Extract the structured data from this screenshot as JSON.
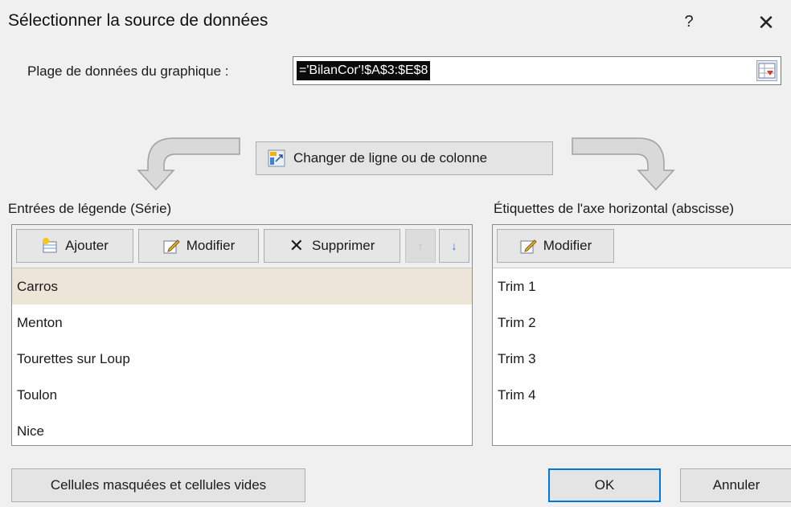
{
  "dialog": {
    "title": "Sélectionner la source de données",
    "help_label": "?",
    "close_label": "✕"
  },
  "range": {
    "label": "Plage de données du graphique :",
    "value": "='BilanCor'!$A$3:$E$8"
  },
  "switch_button": {
    "label": "Changer de ligne ou de colonne"
  },
  "legend": {
    "header": "Entrées de légende (Série)",
    "add_label": "Ajouter",
    "edit_label": "Modifier",
    "delete_label": "Supprimer",
    "up_label": "↑",
    "down_label": "↓",
    "items": [
      "Carros",
      "Menton",
      "Tourettes sur Loup",
      "Toulon",
      "Nice"
    ],
    "selected_index": 0
  },
  "axis": {
    "header": "Étiquettes de l'axe horizontal (abscisse)",
    "edit_label": "Modifier",
    "items": [
      "Trim 1",
      "Trim 2",
      "Trim 3",
      "Trim 4"
    ]
  },
  "footer": {
    "hidden_cells_label": "Cellules masquées et cellules vides",
    "ok_label": "OK",
    "cancel_label": "Annuler"
  },
  "colors": {
    "selected_row": "#ece5d8",
    "default_button_border": "#0078d7",
    "arrow_enabled": "#3b6fd4",
    "arrow_disabled": "#a9c4ea"
  }
}
